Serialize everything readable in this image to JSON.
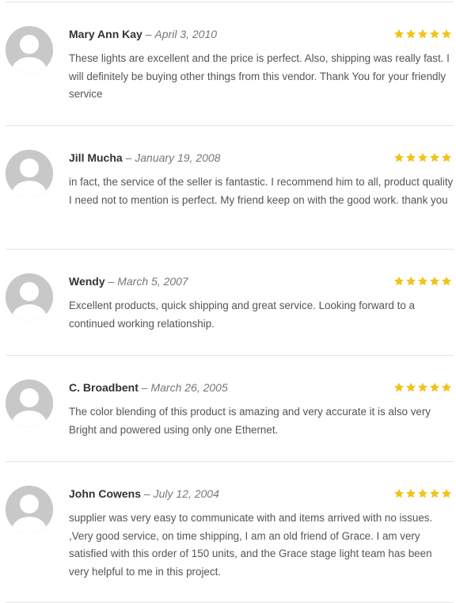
{
  "reviews": [
    {
      "author": "Mary Ann Kay",
      "separator": "–",
      "date": "April 3, 2010",
      "rating": 5,
      "text": "These lights are excellent and the price is perfect. Also, shipping was really fast. I will definitely be buying other things from this vendor. Thank You for your friendly service"
    },
    {
      "author": "Jill Mucha",
      "separator": "–",
      "date": "January 19, 2008",
      "rating": 5,
      "text": "in fact, the service of the seller is fantastic. I recommend him to all, product quality I need not to mention is perfect. My friend keep on with the good work. thank you"
    },
    {
      "author": "Wendy",
      "separator": "–",
      "date": "March 5, 2007",
      "rating": 5,
      "text": "Excellent products, quick shipping and great service. Looking forward to a continued working relationship."
    },
    {
      "author": "C. Broadbent",
      "separator": "–",
      "date": "March 26, 2005",
      "rating": 5,
      "text": "The color blending of this product is amazing and very accurate it is also very Bright and powered using only one Ethernet."
    },
    {
      "author": "John Cowens",
      "separator": "–",
      "date": "July 12, 2004",
      "rating": 5,
      "text": "supplier was very easy to communicate with and items arrived with no issues. ,Very good service, on time shipping, I am an old friend of Grace. I am very satisfied with this order of 150 units, and the Grace stage light team has been very helpful to me in this project."
    }
  ],
  "colors": {
    "star": "#f0c419",
    "avatar_bg": "#c8c8c8",
    "avatar_fg": "#ffffff",
    "divider": "#e4e4e4",
    "author": "#333333",
    "date": "#777777",
    "body": "#555555"
  },
  "icons": {
    "avatar": "default-user-silhouette",
    "rating": "star-filled"
  }
}
